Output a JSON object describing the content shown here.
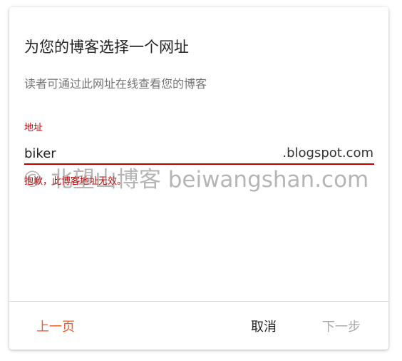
{
  "dialog": {
    "title": "为您的博客选择一个网址",
    "subtitle": "读者可通过此网址在线查看您的博客",
    "field_label": "地址",
    "address_value": "biker",
    "domain_suffix": ".blogspot.com",
    "error_message": "抱歉，此博客地址无效。",
    "prev_label": "上一页",
    "cancel_label": "取消",
    "next_label": "下一步"
  },
  "watermark": "© 北望山博客 beiwangshan.com",
  "colors": {
    "accent": "#f05a28",
    "error": "#c00000",
    "disabled": "#aaaaaa"
  }
}
